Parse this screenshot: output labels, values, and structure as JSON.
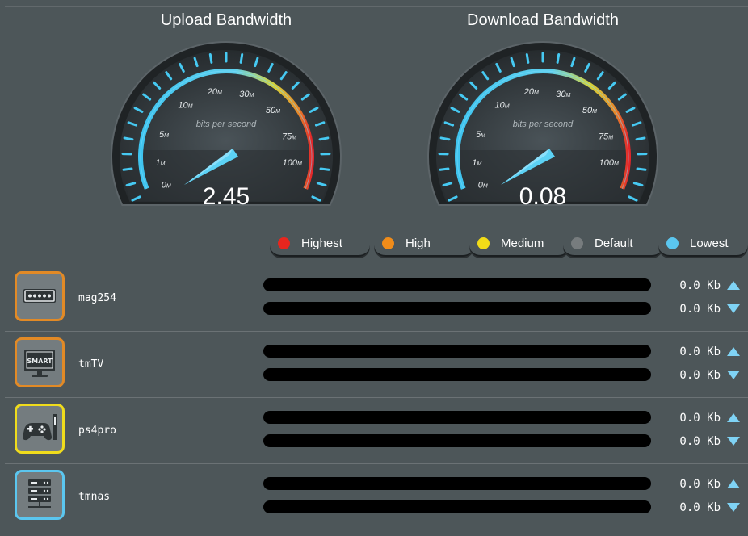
{
  "gauges": {
    "upload": {
      "title": "Upload Bandwidth",
      "value": "2.45",
      "unit_label": "bits per second",
      "scale": [
        "0M",
        "1M",
        "5M",
        "10M",
        "20M",
        "30M",
        "50M",
        "75M",
        "100M"
      ]
    },
    "download": {
      "title": "Download Bandwidth",
      "value": "0.08",
      "unit_label": "bits per second",
      "scale": [
        "0M",
        "1M",
        "5M",
        "10M",
        "20M",
        "30M",
        "50M",
        "75M",
        "100M"
      ]
    }
  },
  "legend": [
    {
      "label": "Highest",
      "color": "#e8261e"
    },
    {
      "label": "High",
      "color": "#f08c1a"
    },
    {
      "label": "Medium",
      "color": "#f2dc17"
    },
    {
      "label": "Default",
      "color": "#777c7e"
    },
    {
      "label": "Lowest",
      "color": "#5bc6ef"
    }
  ],
  "devices": [
    {
      "name": "mag254",
      "icon": "set-top-box-icon",
      "border_color": "#e28a26",
      "up_rate": "0.0 Kb",
      "down_rate": "0.0 Kb"
    },
    {
      "name": "tmTV",
      "icon": "smart-tv-icon",
      "icon_label": "SMART",
      "border_color": "#e28a26",
      "up_rate": "0.0 Kb",
      "down_rate": "0.0 Kb"
    },
    {
      "name": "ps4pro",
      "icon": "game-console-icon",
      "border_color": "#f0dc1c",
      "up_rate": "0.0 Kb",
      "down_rate": "0.0 Kb"
    },
    {
      "name": "tmnas",
      "icon": "nas-server-icon",
      "border_color": "#5bc6ef",
      "up_rate": "0.0 Kb",
      "down_rate": "0.0 Kb"
    }
  ]
}
